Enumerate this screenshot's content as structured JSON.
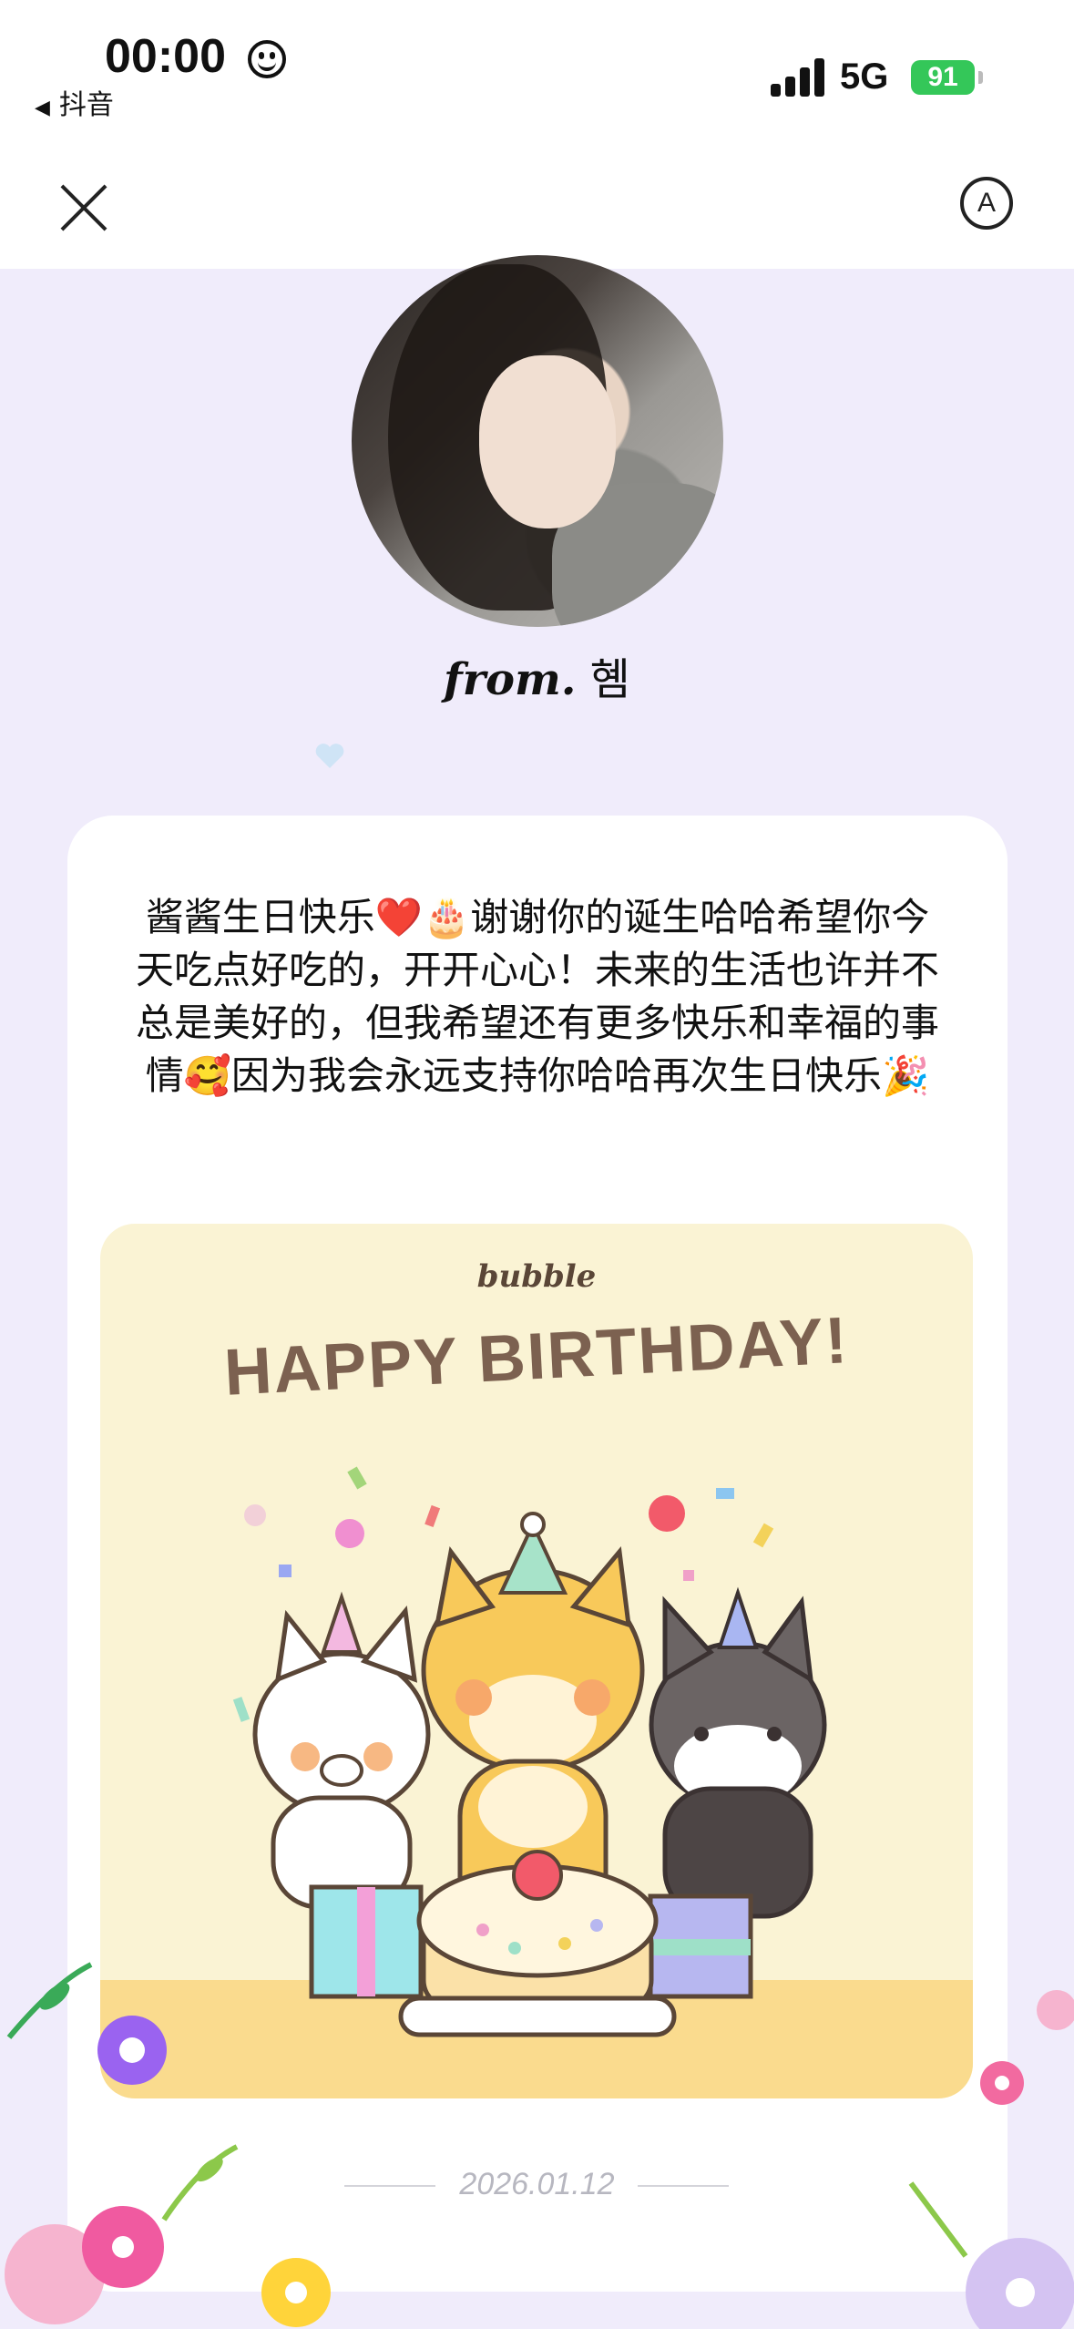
{
  "status_bar": {
    "time": "00:00",
    "back_app": "抖音",
    "network": "5G",
    "battery": "91"
  },
  "icons": {
    "close": "close-icon",
    "translate": "translate-icon",
    "smiley": "smiley-icon",
    "signal": "signal-icon"
  },
  "sender": {
    "from_label": "from.",
    "name": "혬"
  },
  "letter": {
    "message": "酱酱生日快乐❤️🎂谢谢你的诞生哈哈希望你今天吃点好吃的，开开心心！未来的生活也许并不总是美好的，但我希望还有更多快乐和幸福的事情🥰因为我会永远支持你哈哈再次生日快乐🎉",
    "card_brand": "bubble",
    "card_title": "HAPPY BIRTHDAY!",
    "date": "2026.01.12"
  },
  "colors": {
    "page_bg": "#f0ecfb",
    "battery": "#34c759",
    "card_bg": "#faf3d4",
    "card_floor": "#fadb8e",
    "title_text": "#7c6150"
  }
}
